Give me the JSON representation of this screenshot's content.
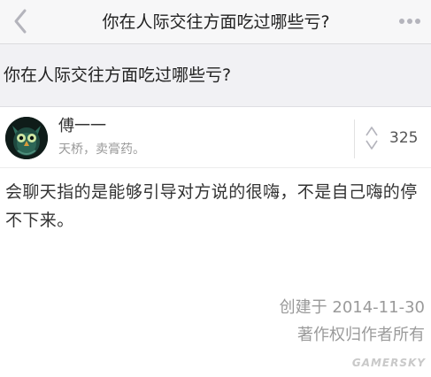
{
  "nav": {
    "back_icon": "chevron-left-icon",
    "title": "你在人际交往方面吃过哪些亏?",
    "more_icon": "ellipsis-icon"
  },
  "question": {
    "title": "你在人际交往方面吃过哪些亏?"
  },
  "author": {
    "avatar_icon": "owl-avatar",
    "name": "傅一一",
    "bio": "天桥，卖膏药。"
  },
  "vote": {
    "icon": "up-down-arrow-icon",
    "count": "325"
  },
  "answer": {
    "content": "会聊天指的是能够引导对方说的很嗨，不是自己嗨的停不下来。"
  },
  "meta": {
    "created": "创建于 2014-11-30",
    "copyright": "著作权归作者所有"
  },
  "watermark": "GAMERSKY",
  "colors": {
    "nav_bg": "#f7f7f8",
    "question_bg": "#f1f1f4",
    "text_primary": "#333333",
    "text_muted": "#999999",
    "icon_gray": "#b4b4bc"
  }
}
